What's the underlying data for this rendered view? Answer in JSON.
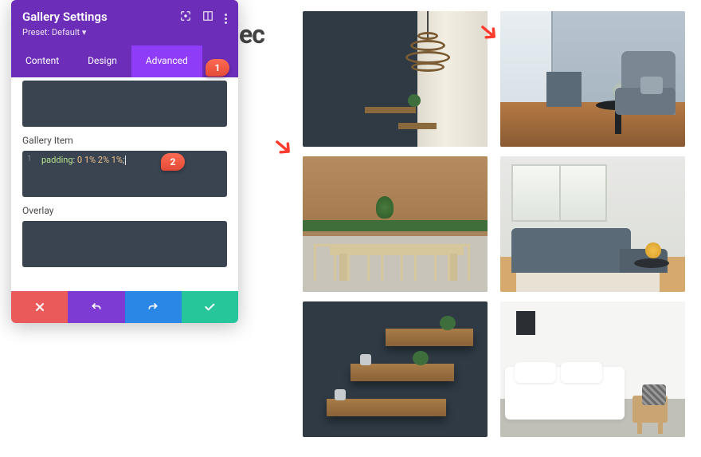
{
  "panel": {
    "title": "Gallery Settings",
    "preset": "Preset: Default ▾",
    "tabs": {
      "content": "Content",
      "design": "Design",
      "advanced": "Advanced"
    },
    "sections": {
      "gallery_item": "Gallery Item",
      "overlay": "Overlay"
    },
    "code": {
      "line_no": "1",
      "property": "padding",
      "value": "0 1% 2% 1%",
      "full": "padding: 0 1% 2% 1%;"
    },
    "colors": {
      "header": "#6c2eb9",
      "tab_active": "#8e3cf7",
      "cancel": "#eb5a5a",
      "undo": "#7d3bd4",
      "redo": "#2b87e6",
      "save": "#27c59a"
    }
  },
  "callouts": {
    "one": "1",
    "two": "2"
  },
  "background_fragment": "ec",
  "header_icons": {
    "focus": "focus-icon",
    "column": "split-view-icon",
    "more": "more-icon"
  },
  "gallery_tiles": [
    "dark-wall-pendant-room",
    "corner-armchair-cube",
    "outdoor-wooden-table",
    "living-room-sectional",
    "floating-wood-shelves",
    "white-bedroom-stool"
  ]
}
